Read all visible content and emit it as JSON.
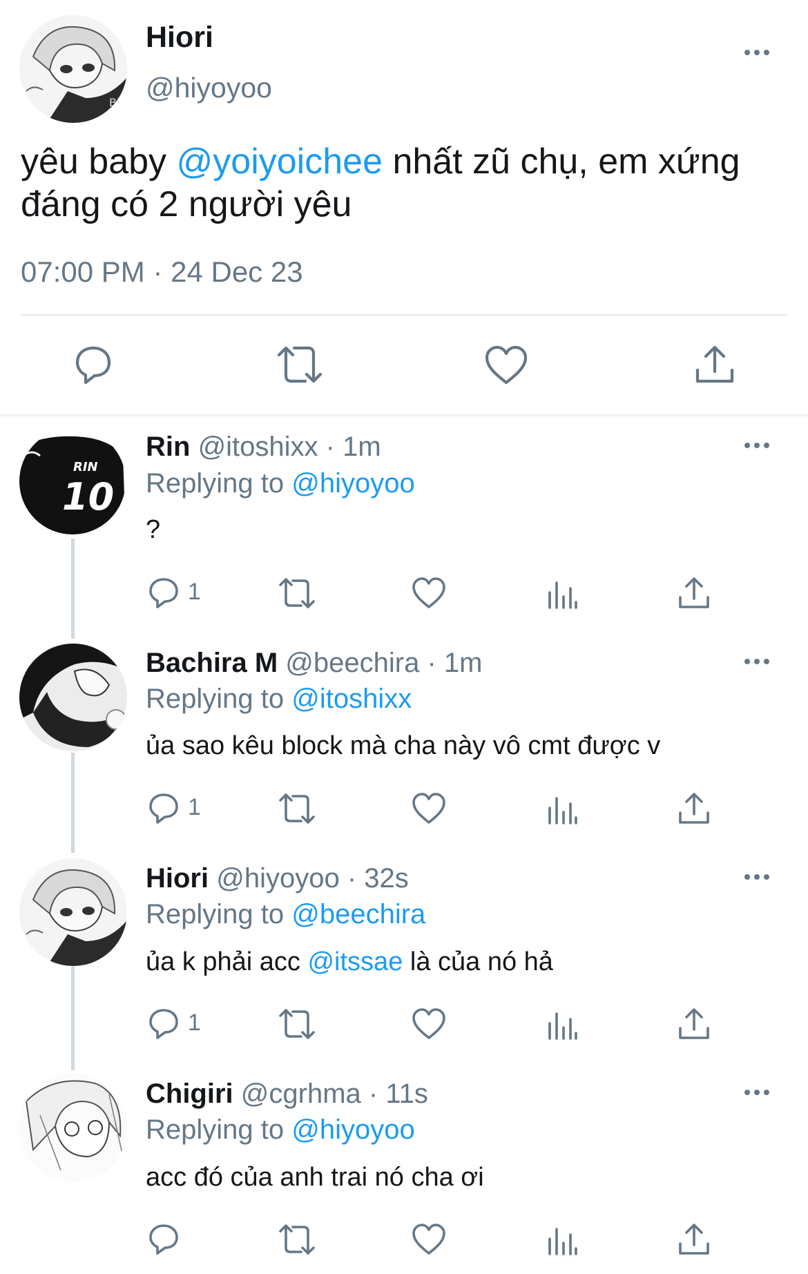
{
  "main_tweet": {
    "author_name": "Hiori",
    "author_handle": "@hiyoyoo",
    "text_before": "yêu baby ",
    "mention": "@yoiyoichee",
    "text_after": " nhất zũ chụ, em xứng",
    "text_line2": "đáng có 2 người yêu",
    "timestamp": "07:00 PM · 24 Dec 23",
    "actions": [
      "reply-icon",
      "retweet-icon",
      "like-icon",
      "share-icon"
    ]
  },
  "replies": [
    {
      "name": "Rin",
      "handle": "@itoshixx",
      "time": "· 1m",
      "replying_label": "Replying to",
      "replying_to": "@hiyoyoo",
      "text_before": "?",
      "mention": "",
      "text_after": "",
      "reply_count": "1"
    },
    {
      "name": "Bachira M",
      "handle": "@beechira",
      "time": "· 1m",
      "replying_label": "Replying to",
      "replying_to": "@itoshixx",
      "text_before": "ủa sao kêu block mà cha này vô cmt được v",
      "mention": "",
      "text_after": "",
      "reply_count": "1"
    },
    {
      "name": "Hiori",
      "handle": "@hiyoyoo",
      "time": "· 32s",
      "replying_label": "Replying to",
      "replying_to": "@beechira",
      "text_before": "ủa k phải acc ",
      "mention": "@itssae",
      "text_after": " là của nó hả",
      "reply_count": "1"
    },
    {
      "name": "Chigiri",
      "handle": "@cgrhma",
      "time": "· 11s",
      "replying_label": "Replying to",
      "replying_to": "@hiyoyoo",
      "text_before": "acc đó của anh trai nó cha ơi",
      "mention": "",
      "text_after": "",
      "reply_count": ""
    }
  ],
  "avatar_labels": {
    "rin_jersey_name": "RIN",
    "rin_jersey_number": "10"
  },
  "colors": {
    "accent": "#1d9bf0",
    "secondary_text": "#657786",
    "primary_text": "#14171a",
    "divider": "#eff3f4",
    "thread_line": "#cfd9de"
  }
}
